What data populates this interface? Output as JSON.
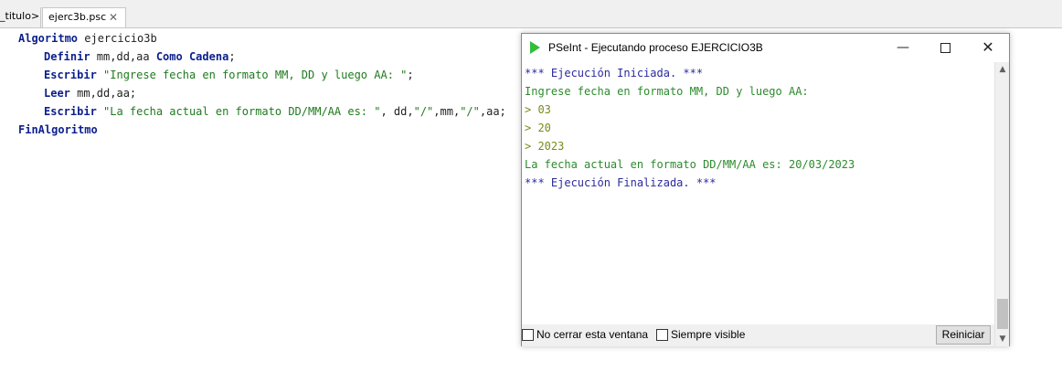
{
  "tabs": {
    "previous_label": "_titulo>",
    "active_label": "ejerc3b.psc",
    "close_glyph": "✕"
  },
  "editor": {
    "lines": [
      {
        "kw1": "Algoritmo",
        "text1": " ejercicio3b"
      },
      {
        "kw1": "Definir",
        "text1": " mm,dd,aa ",
        "kw2": "Como Cadena",
        "text2": ";"
      },
      {
        "kw1": "Escribir",
        "text1": " ",
        "str1": "\"Ingrese fecha en formato MM, DD y luego AA: \"",
        "text2": ";"
      },
      {
        "kw1": "Leer",
        "text1": " mm,dd,aa;"
      },
      {
        "kw1": "Escribir",
        "text1": " ",
        "str1": "\"La fecha actual en formato DD/MM/AA es: \"",
        "text2": ", dd,",
        "str2": "\"/\"",
        "text3": ",mm,",
        "str3": "\"/\"",
        "text4": ",aa;"
      },
      {
        "kw1": "FinAlgoritmo"
      }
    ]
  },
  "window": {
    "title": "PSeInt - Ejecutando proceso EJERCICIO3B",
    "icon": "pseint-play-icon",
    "minimize_glyph": "—",
    "close_glyph": "✕"
  },
  "console": {
    "lines": [
      "*** Ejecución Iniciada. ***",
      "Ingrese fecha en formato MM, DD y luego AA:",
      "> 03",
      "> 20",
      "> 2023",
      "La fecha actual en formato DD/MM/AA es: 20/03/2023",
      "*** Ejecución Finalizada. ***"
    ]
  },
  "bottom": {
    "no_cerrar_label": "No cerrar esta ventana",
    "siempre_visible_label": "Siempre visible",
    "reiniciar_label": "Reiniciar"
  },
  "scroll": {
    "up_glyph": "▲",
    "down_glyph": "▼"
  },
  "colors": {
    "keyword": "#0c1f8c",
    "string": "#1f7a1f",
    "console_info": "#2a2a9e",
    "console_output": "#2d8a2d",
    "console_input": "#7a8a1a",
    "pseint_icon": "#2fbf38"
  }
}
